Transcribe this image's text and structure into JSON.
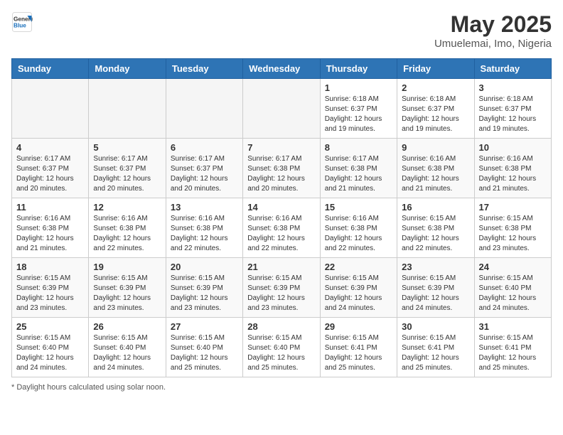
{
  "header": {
    "logo_general": "General",
    "logo_blue": "Blue",
    "month_year": "May 2025",
    "location": "Umuelemai, Imo, Nigeria"
  },
  "weekdays": [
    "Sunday",
    "Monday",
    "Tuesday",
    "Wednesday",
    "Thursday",
    "Friday",
    "Saturday"
  ],
  "footer": {
    "note": "Daylight hours"
  },
  "weeks": [
    {
      "days": [
        {
          "num": "",
          "info": ""
        },
        {
          "num": "",
          "info": ""
        },
        {
          "num": "",
          "info": ""
        },
        {
          "num": "",
          "info": ""
        },
        {
          "num": "1",
          "info": "Sunrise: 6:18 AM\nSunset: 6:37 PM\nDaylight: 12 hours\nand 19 minutes."
        },
        {
          "num": "2",
          "info": "Sunrise: 6:18 AM\nSunset: 6:37 PM\nDaylight: 12 hours\nand 19 minutes."
        },
        {
          "num": "3",
          "info": "Sunrise: 6:18 AM\nSunset: 6:37 PM\nDaylight: 12 hours\nand 19 minutes."
        }
      ]
    },
    {
      "days": [
        {
          "num": "4",
          "info": "Sunrise: 6:17 AM\nSunset: 6:37 PM\nDaylight: 12 hours\nand 20 minutes."
        },
        {
          "num": "5",
          "info": "Sunrise: 6:17 AM\nSunset: 6:37 PM\nDaylight: 12 hours\nand 20 minutes."
        },
        {
          "num": "6",
          "info": "Sunrise: 6:17 AM\nSunset: 6:37 PM\nDaylight: 12 hours\nand 20 minutes."
        },
        {
          "num": "7",
          "info": "Sunrise: 6:17 AM\nSunset: 6:38 PM\nDaylight: 12 hours\nand 20 minutes."
        },
        {
          "num": "8",
          "info": "Sunrise: 6:17 AM\nSunset: 6:38 PM\nDaylight: 12 hours\nand 21 minutes."
        },
        {
          "num": "9",
          "info": "Sunrise: 6:16 AM\nSunset: 6:38 PM\nDaylight: 12 hours\nand 21 minutes."
        },
        {
          "num": "10",
          "info": "Sunrise: 6:16 AM\nSunset: 6:38 PM\nDaylight: 12 hours\nand 21 minutes."
        }
      ]
    },
    {
      "days": [
        {
          "num": "11",
          "info": "Sunrise: 6:16 AM\nSunset: 6:38 PM\nDaylight: 12 hours\nand 21 minutes."
        },
        {
          "num": "12",
          "info": "Sunrise: 6:16 AM\nSunset: 6:38 PM\nDaylight: 12 hours\nand 22 minutes."
        },
        {
          "num": "13",
          "info": "Sunrise: 6:16 AM\nSunset: 6:38 PM\nDaylight: 12 hours\nand 22 minutes."
        },
        {
          "num": "14",
          "info": "Sunrise: 6:16 AM\nSunset: 6:38 PM\nDaylight: 12 hours\nand 22 minutes."
        },
        {
          "num": "15",
          "info": "Sunrise: 6:16 AM\nSunset: 6:38 PM\nDaylight: 12 hours\nand 22 minutes."
        },
        {
          "num": "16",
          "info": "Sunrise: 6:15 AM\nSunset: 6:38 PM\nDaylight: 12 hours\nand 22 minutes."
        },
        {
          "num": "17",
          "info": "Sunrise: 6:15 AM\nSunset: 6:38 PM\nDaylight: 12 hours\nand 23 minutes."
        }
      ]
    },
    {
      "days": [
        {
          "num": "18",
          "info": "Sunrise: 6:15 AM\nSunset: 6:39 PM\nDaylight: 12 hours\nand 23 minutes."
        },
        {
          "num": "19",
          "info": "Sunrise: 6:15 AM\nSunset: 6:39 PM\nDaylight: 12 hours\nand 23 minutes."
        },
        {
          "num": "20",
          "info": "Sunrise: 6:15 AM\nSunset: 6:39 PM\nDaylight: 12 hours\nand 23 minutes."
        },
        {
          "num": "21",
          "info": "Sunrise: 6:15 AM\nSunset: 6:39 PM\nDaylight: 12 hours\nand 23 minutes."
        },
        {
          "num": "22",
          "info": "Sunrise: 6:15 AM\nSunset: 6:39 PM\nDaylight: 12 hours\nand 24 minutes."
        },
        {
          "num": "23",
          "info": "Sunrise: 6:15 AM\nSunset: 6:39 PM\nDaylight: 12 hours\nand 24 minutes."
        },
        {
          "num": "24",
          "info": "Sunrise: 6:15 AM\nSunset: 6:40 PM\nDaylight: 12 hours\nand 24 minutes."
        }
      ]
    },
    {
      "days": [
        {
          "num": "25",
          "info": "Sunrise: 6:15 AM\nSunset: 6:40 PM\nDaylight: 12 hours\nand 24 minutes."
        },
        {
          "num": "26",
          "info": "Sunrise: 6:15 AM\nSunset: 6:40 PM\nDaylight: 12 hours\nand 24 minutes."
        },
        {
          "num": "27",
          "info": "Sunrise: 6:15 AM\nSunset: 6:40 PM\nDaylight: 12 hours\nand 25 minutes."
        },
        {
          "num": "28",
          "info": "Sunrise: 6:15 AM\nSunset: 6:40 PM\nDaylight: 12 hours\nand 25 minutes."
        },
        {
          "num": "29",
          "info": "Sunrise: 6:15 AM\nSunset: 6:41 PM\nDaylight: 12 hours\nand 25 minutes."
        },
        {
          "num": "30",
          "info": "Sunrise: 6:15 AM\nSunset: 6:41 PM\nDaylight: 12 hours\nand 25 minutes."
        },
        {
          "num": "31",
          "info": "Sunrise: 6:15 AM\nSunset: 6:41 PM\nDaylight: 12 hours\nand 25 minutes."
        }
      ]
    }
  ]
}
